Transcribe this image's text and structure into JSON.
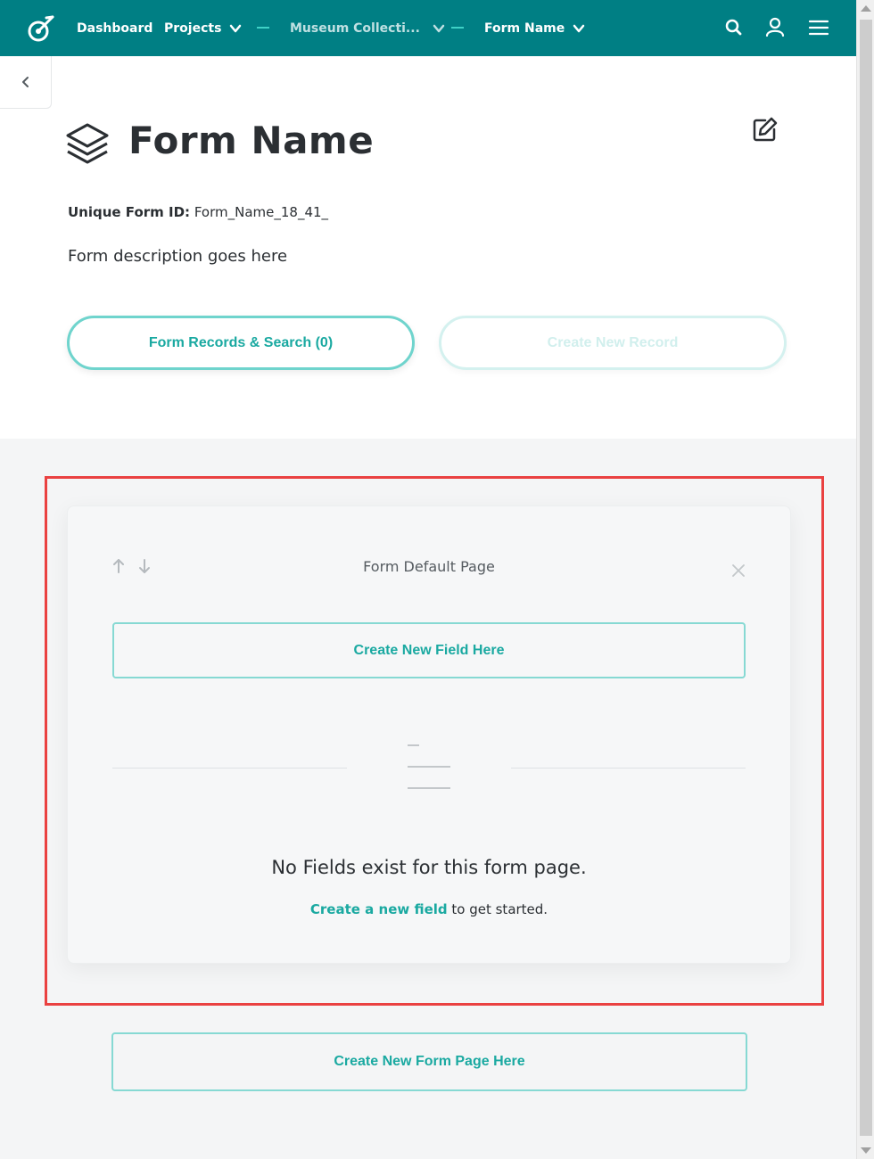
{
  "nav": {
    "logo_icon": "kora-logo-icon",
    "dashboard_label": "Dashboard",
    "projects_label": "Projects",
    "project_label": "Museum Collecti...",
    "form_label": "Form Name",
    "icons": [
      "search-icon",
      "user-icon",
      "menu-icon"
    ]
  },
  "header": {
    "back_icon": "chevron-left-icon",
    "title": "Form Name",
    "uid_label": "Unique Form ID:",
    "uid_value": "Form_Name_18_41_",
    "description": "Form description goes here",
    "records_button": "Form Records & Search (0)",
    "create_record_button": "Create New Record"
  },
  "page_card": {
    "title": "Form Default Page",
    "create_field_button": "Create New Field Here",
    "empty_title": "No Fields exist for this form page.",
    "empty_link": "Create a new field",
    "empty_suffix": " to get started."
  },
  "footer": {
    "new_page_button": "Create New Form Page Here"
  },
  "colors": {
    "brand": "#007f84",
    "accent": "#1aa9a1",
    "highlight": "#ea4141"
  }
}
